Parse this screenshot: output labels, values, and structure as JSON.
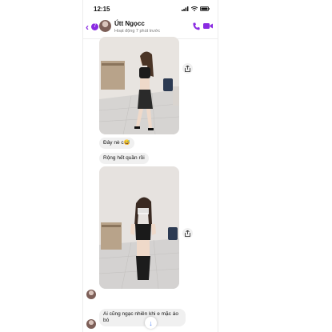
{
  "status_bar": {
    "time": "12:15"
  },
  "header": {
    "back_icon": "chevron-left-icon",
    "unread_count": "7",
    "contact_name": "Útt Ngọcc",
    "activity": "Hoạt động 7 phút trước",
    "accent_color": "#8a2be2"
  },
  "messages": {
    "text_1": "Đây nè c😅",
    "text_2": "Rộng hết quần rồi",
    "text_3": "Ai cũng ngạc nhiên khi e mặc áo bó"
  },
  "scroll_button": {
    "icon": "arrow-down-icon",
    "glyph": "↓"
  }
}
